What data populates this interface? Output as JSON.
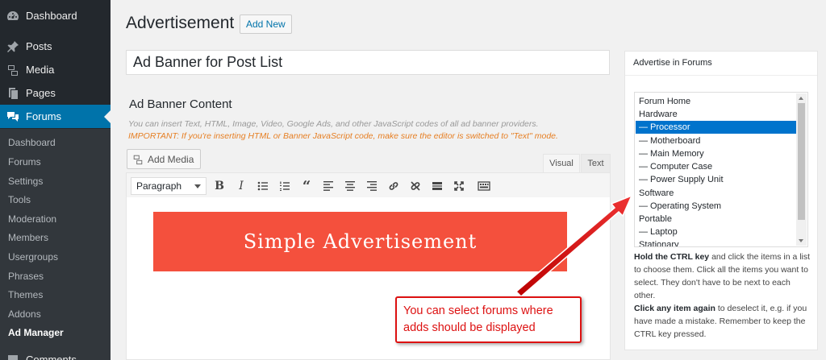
{
  "sidebar": {
    "menu": [
      {
        "label": "Dashboard",
        "icon": "dashboard-icon"
      },
      {
        "label": "Posts",
        "icon": "pin-icon"
      },
      {
        "label": "Media",
        "icon": "media-icon"
      },
      {
        "label": "Pages",
        "icon": "pages-icon"
      },
      {
        "label": "Forums",
        "icon": "forums-icon"
      },
      {
        "label": "Comments",
        "icon": "comments-icon"
      }
    ],
    "submenu": [
      "Dashboard",
      "Forums",
      "Settings",
      "Tools",
      "Moderation",
      "Members",
      "Usergroups",
      "Phrases",
      "Themes",
      "Addons",
      "Ad Manager"
    ]
  },
  "header": {
    "title": "Advertisement",
    "add_new": "Add New"
  },
  "post_title": "Ad Banner for Post List",
  "content": {
    "heading": "Ad Banner Content",
    "note": "You can insert Text, HTML, Image, Video, Google Ads, and other JavaScript codes of all ad banner providers.",
    "important": "IMPORTANT: If you're inserting HTML or Banner JavaScript code, make sure the editor is switched to \"Text\" mode."
  },
  "editor": {
    "add_media": "Add Media",
    "tab_visual": "Visual",
    "tab_text": "Text",
    "format": "Paragraph",
    "banner_text": "Simple Advertisement",
    "banner_color": "#f4503d"
  },
  "forums_box": {
    "title": "Advertise in Forums",
    "options": [
      "Forum Home",
      "Hardware",
      "— Processor",
      "— Motherboard",
      "— Main Memory",
      "— Computer Case",
      "— Power Supply Unit",
      "Software",
      "— Operating System",
      "Portable",
      "— Laptop",
      "Stationary"
    ],
    "selected_index": 2,
    "help_1_bold": "Hold the CTRL key",
    "help_1": " and click the items in a list to choose them. Click all the items you want to select. They don't have to be next to each other.",
    "help_2_bold": "Click any item again",
    "help_2": " to deselect it, e.g. if you have made a mistake. Remember to keep the CTRL key pressed."
  },
  "callout": {
    "text": "You can select forums where adds should be displayed",
    "color": "#dd1111"
  },
  "colors": {
    "sidebar_bg": "#23282d",
    "active_bg": "#0073aa",
    "selected_option": "#0073cc"
  }
}
